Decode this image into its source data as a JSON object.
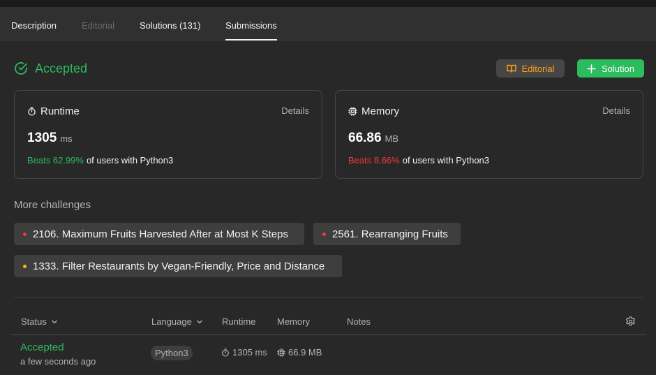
{
  "tabs": [
    {
      "label": "Description",
      "state": "normal"
    },
    {
      "label": "Editorial",
      "state": "disabled"
    },
    {
      "label": "Solutions (131)",
      "state": "normal"
    },
    {
      "label": "Submissions",
      "state": "active"
    }
  ],
  "result": {
    "status": "Accepted",
    "icon": "check-circle-icon",
    "color": "#2cbb5d"
  },
  "actions": {
    "editorial_label": "Editorial",
    "editorial_icon": "book-icon",
    "solution_label": "Solution",
    "solution_icon": "plus-icon"
  },
  "runtime_card": {
    "title": "Runtime",
    "icon": "stopwatch-icon",
    "details_label": "Details",
    "value": "1305",
    "unit": "ms",
    "beats": "Beats 62.99%",
    "beats_suffix": "of users with Python3",
    "beats_color": "#2cbb5d"
  },
  "memory_card": {
    "title": "Memory",
    "icon": "chip-icon",
    "details_label": "Details",
    "value": "66.86",
    "unit": "MB",
    "beats": "Beats 8.66%",
    "beats_suffix": "of users with Python3",
    "beats_color": "#f63636"
  },
  "more_challenges": {
    "title": "More challenges",
    "items": [
      {
        "label": "2106. Maximum Fruits Harvested After at Most K Steps",
        "difficulty_color": "#f63737"
      },
      {
        "label": "2561. Rearranging Fruits",
        "difficulty_color": "#f63737"
      },
      {
        "label": "1333. Filter Restaurants by Vegan-Friendly, Price and Distance",
        "difficulty_color": "#ffb800"
      }
    ]
  },
  "table": {
    "headers": {
      "status": "Status",
      "language": "Language",
      "runtime": "Runtime",
      "memory": "Memory",
      "notes": "Notes"
    },
    "settings_icon": "gear-icon",
    "rows": [
      {
        "status": "Accepted",
        "time": "a few seconds ago",
        "language": "Python3",
        "runtime": "1305 ms",
        "memory": "66.9 MB"
      }
    ]
  }
}
